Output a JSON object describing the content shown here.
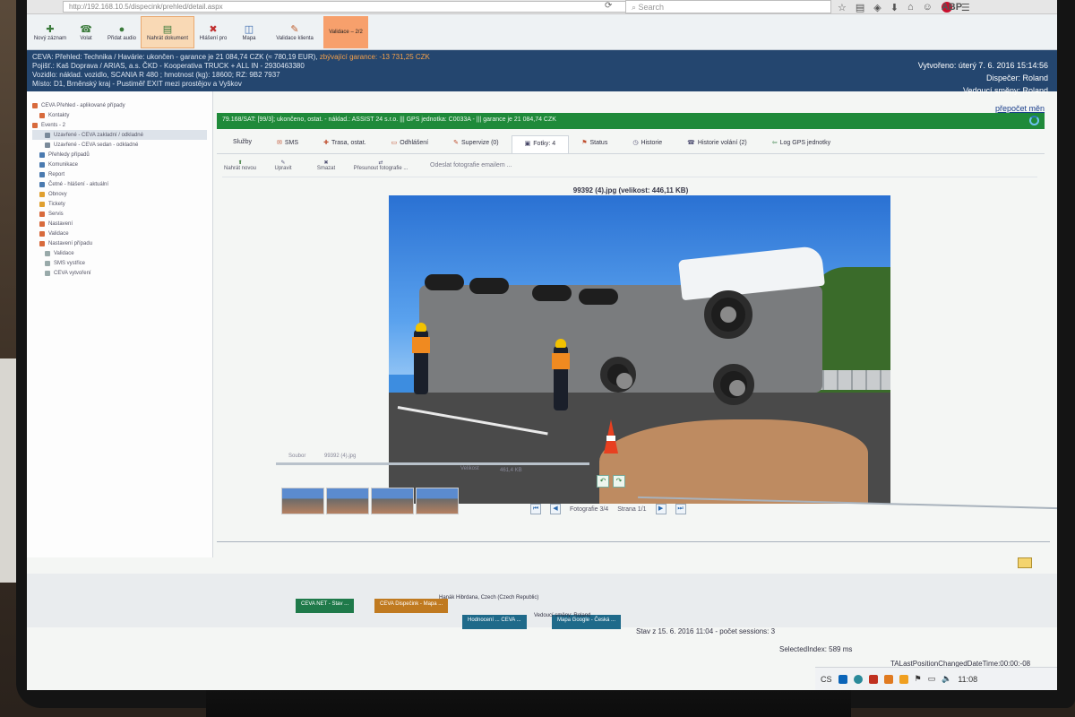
{
  "browser": {
    "url": "http://192.168.10.5/dispecink/prehled/detail.aspx",
    "search_placeholder": "Search"
  },
  "toolbar": {
    "buttons": [
      {
        "label": "Nový záznam"
      },
      {
        "label": "Volat"
      },
      {
        "label": "Přidat audio"
      },
      {
        "label": "Nahrát dokument"
      },
      {
        "label": "Hlášení pro"
      },
      {
        "label": "Mapa"
      },
      {
        "label": "Validace klienta"
      },
      {
        "label": "Validace – 2/2"
      }
    ]
  },
  "info_band": {
    "line1": "CEVA: Přehled: Technika / Havárie: ukončen - garance je 21 084,74 CZK (≈ 780,19 EUR),",
    "line1_orange": "zbývající garance: -13 731,25 CZK",
    "line2": "Pojišť.: Kaš Doprava / ARIAS, a.s.   ČKD - Kooperativa TRUCK + ALL IN - 2930463380",
    "line3": "Vozidlo: náklad. vozidlo, SCANIA R 480 ; hmotnost (kg): 18600; RZ: 9B2 7937",
    "line4": "Místo: D1, Brněnský kraj - Pustiměř EXIT mezi prostějov a Vyškov",
    "created": "Vytvořeno: úterý 7. 6. 2016 15:14:56",
    "dispatcher": "Dispečer: Roland",
    "shift_lead": "Vedoucí směny: Roland"
  },
  "sidebar": {
    "items": [
      "CEVA Přehled - aplikované případy",
      "Kontakty",
      "Events - 2",
      "Uzavřené - CEVA zakladní / odkladné",
      "Uzavřené - CEVA sedan - odkladné",
      "Přehledy případů",
      "Komunikace",
      "Report",
      "Četné - hlášení - aktuální",
      "Obnovy",
      "Tickety",
      "Servis",
      "Nastavení",
      "Validace",
      "Nastavení případu",
      "Validace",
      "SMS vystřice",
      "CEVA vytvoření"
    ]
  },
  "main": {
    "recalc_link": "přepočet měn",
    "green_bar": "79.168/SAT: [99/3]; ukončeno, ostat. - náklad.: ASSIST 24 s.r.o.  ||| GPS jednotka: C0033A -  ||| garance je 21 084,74 CZK",
    "tabs": [
      {
        "label": "Služby"
      },
      {
        "label": "SMS"
      },
      {
        "label": "Trasa, ostat."
      },
      {
        "label": "Odhlášení"
      },
      {
        "label": "Supervize (0)"
      },
      {
        "label": "Fotky: 4"
      },
      {
        "label": "Status"
      },
      {
        "label": "Historie"
      },
      {
        "label": "Historie volání (2)"
      },
      {
        "label": "Log GPS jednotky"
      }
    ],
    "sub_toolbar": {
      "upload": "Nahrát novou",
      "edit": "Upravit",
      "delete": "Smazat",
      "move": "Přesunout fotografie ...",
      "email": "Odeslat fotografie emailem ..."
    },
    "photo_title": "99392 (4).jpg (velikost: 446,11 KB)",
    "photo_footer_left_label": "Soubor",
    "photo_footer_left_value": "99392 (4).jpg",
    "photo_footer_mid_label": "Velikost",
    "photo_footer_mid_value": "461,4 KB",
    "pager_photo": "Fotografie 3/4",
    "pager_page": "Strana 1/1"
  },
  "status": {
    "tasks": [
      "CEVA NET - Stav ...",
      "CEVA Dispečink - Mapa ...",
      "Hodnocení ... CEVA ...",
      "Mapa Google - Česká ..."
    ],
    "place": "Hanák Hibrdana, Czech (Czech Republic)",
    "shift_lead": "Vedoucí směny: Roland",
    "state": "Stav z 15. 6. 2016 11:04 - počet sessions: 3",
    "selected_index": "SelectedIndex: 589 ms",
    "last_position": "TALastPositionChangedDateTime:00:00:-08",
    "lang": "CS",
    "clock": "11:08"
  }
}
